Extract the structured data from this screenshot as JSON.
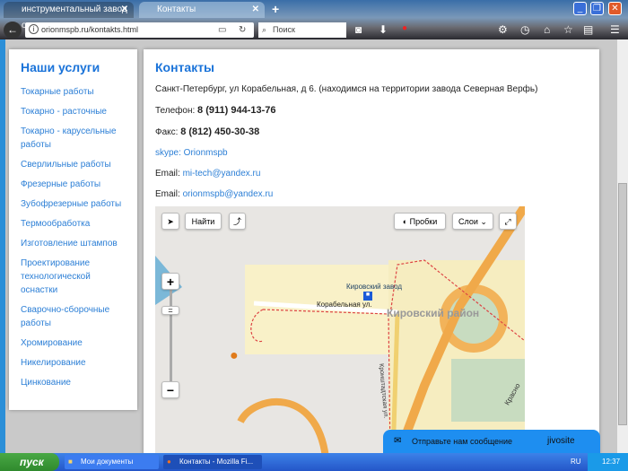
{
  "browser": {
    "tabs": [
      {
        "label": "инструментальный завод о..."
      },
      {
        "label": "Контакты"
      }
    ],
    "url": "orionmspb.ru/kontakts.html",
    "search_placeholder": "Поиск"
  },
  "sidebar": {
    "title": "Наши услуги",
    "items": [
      "Токарные работы",
      "Токарно - расточные",
      "Токарно - карусельные работы",
      "Сверлильные работы",
      "Фрезерные работы",
      "Зубофрезерные работы",
      "Термообработка",
      "Изготовление штампов",
      "Проектирование технологической оснастки",
      "Сварочно-сборочные работы",
      "Хромирование",
      "Никелирование",
      "Цинкование"
    ]
  },
  "contacts": {
    "title": "Контакты",
    "address": "Санкт-Петербург, ул Корабельная, д 6. (находимся на территории завода Северная Верфь)",
    "phone_label": "Телефон:",
    "phone": "8 (911) 944-13-76",
    "fax_label": "Факс:",
    "fax": "8 (812) 450-30-38",
    "skype": "skype: Orionmspb",
    "email_label": "Email:",
    "email1": "mi-tech@yandex.ru",
    "email2": "orionmspb@yandex.ru"
  },
  "map": {
    "find": "Найти",
    "traffic": "Пробки",
    "layers": "Слои",
    "labels": {
      "station": "Кировский завод",
      "street": "Корабельная ул.",
      "district": "Кировский район",
      "street2": "Кронштадтская ул.",
      "street3": "Красно"
    }
  },
  "jivo": {
    "message": "Отправьте нам сообщение",
    "brand": "jivosite"
  },
  "taskbar": {
    "start": "пуск",
    "tasks": [
      "Мои документы",
      "Контакты - Mozilla Fi..."
    ],
    "lang": "RU",
    "time": "12:37"
  }
}
